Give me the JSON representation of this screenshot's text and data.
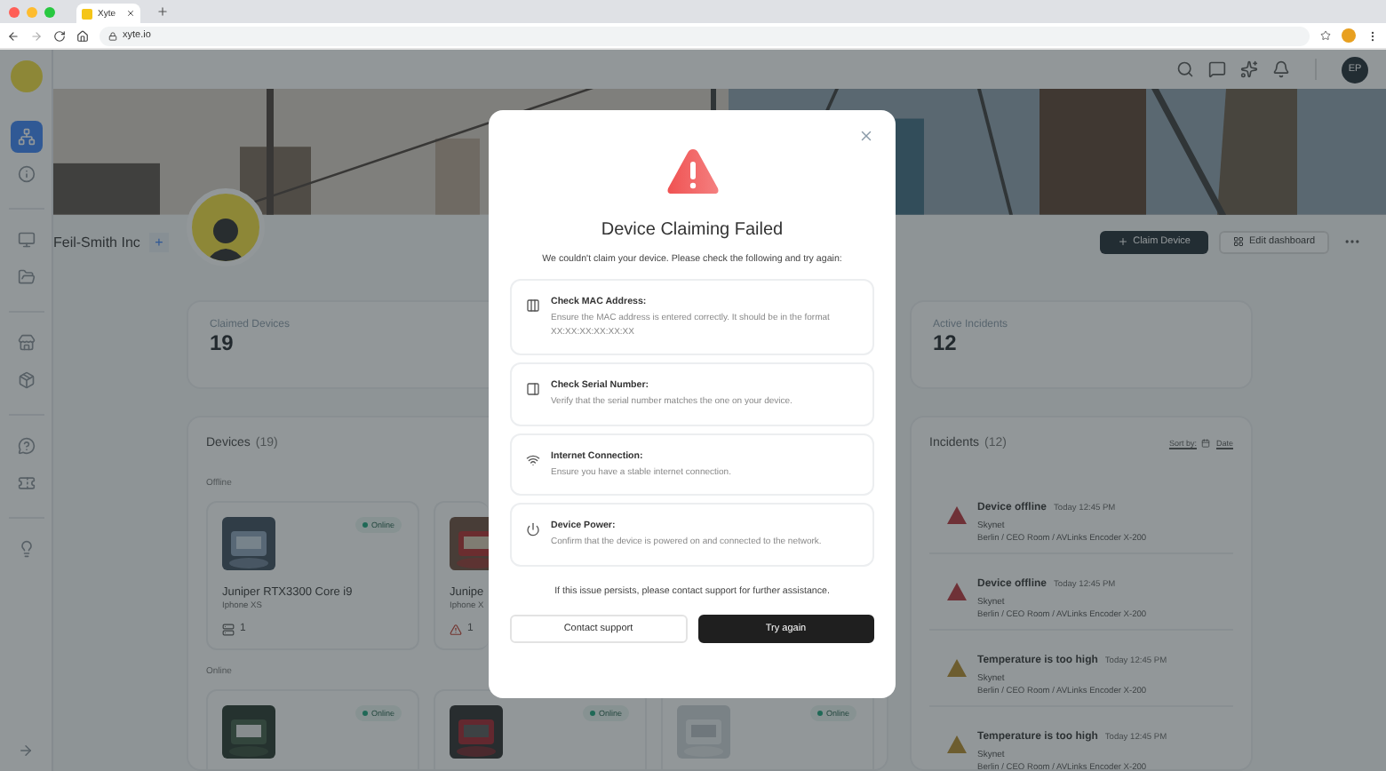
{
  "browser": {
    "tab_title": "Xyte",
    "url": "xyte.io"
  },
  "sidebar": {
    "items": [
      {
        "selected": true
      },
      {
        "selected": false
      },
      {
        "selected": false
      },
      {
        "selected": false
      },
      {
        "selected": false
      },
      {
        "selected": false
      },
      {
        "selected": false
      },
      {
        "selected": false
      },
      {
        "selected": false
      }
    ]
  },
  "header": {
    "avatar_initials": "EP"
  },
  "organization": {
    "name": "Feil-Smith Inc",
    "add_label": "+",
    "claim_button": "Claim Device",
    "edit_button": "Edit dashboard"
  },
  "stats": [
    {
      "label": "Claimed Devices",
      "value": "19"
    },
    {
      "label": "Active Incidents",
      "value": "12"
    }
  ],
  "devices": {
    "title": "Devices",
    "count": "(19)",
    "groups": [
      {
        "label": "Offline",
        "cards": [
          {
            "status": "Online",
            "name": "Juniper RTX3300 Core i9",
            "model": "Iphone XS",
            "footer": {
              "kind": "ports",
              "count": "1"
            }
          },
          {
            "name": "Junipe",
            "model": "Iphone X",
            "footer": {
              "kind": "warning",
              "count": "1"
            }
          }
        ]
      },
      {
        "label": "Online",
        "cards": [
          {
            "status": "Online"
          },
          {
            "status": "Online"
          },
          {
            "status": "Online"
          }
        ]
      }
    ]
  },
  "incidents": {
    "title": "Incidents",
    "count": "(12)",
    "sort_label": "Sort by:",
    "sort_value": "Date",
    "items": [
      {
        "kind": "error",
        "title": "Device offline",
        "time": "Today 12:45 PM",
        "source": "Skynet",
        "path": "Berlin / CEO Room / AVLinks Encoder X-200"
      },
      {
        "kind": "error",
        "title": "Device offline",
        "time": "Today 12:45 PM",
        "source": "Skynet",
        "path": "Berlin / CEO Room / AVLinks Encoder X-200"
      },
      {
        "kind": "warning",
        "title": "Temperature is too high",
        "time": "Today 12:45 PM",
        "source": "Skynet",
        "path": "Berlin / CEO Room / AVLinks Encoder X-200"
      },
      {
        "kind": "warning",
        "title": "Temperature is too high",
        "time": "Today 12:45 PM",
        "source": "Skynet",
        "path": "Berlin / CEO Room / AVLinks Encoder X-200"
      }
    ]
  },
  "modal": {
    "title": "Device Claiming Failed",
    "message": "We couldn't claim your device. Please check the following and try again:",
    "checks": [
      {
        "kind": "mac",
        "title": "Check MAC Address:",
        "description": "Ensure the MAC address is entered correctly. It should be in the format XX:XX:XX:XX:XX:XX"
      },
      {
        "kind": "serial",
        "title": "Check Serial Number:",
        "description": "Verify that the serial number matches the one on your device."
      },
      {
        "kind": "wifi",
        "title": "Internet Connection:",
        "description": "Ensure you have a stable internet connection."
      },
      {
        "kind": "power",
        "title": "Device Power:",
        "description": "Confirm that the device is powered on and connected to the network."
      }
    ],
    "footer": "If this issue persists, please contact support for further assistance.",
    "buttons": [
      {
        "kind": "secondary",
        "label": "Contact support"
      },
      {
        "kind": "primary",
        "label": "Try again"
      }
    ]
  }
}
